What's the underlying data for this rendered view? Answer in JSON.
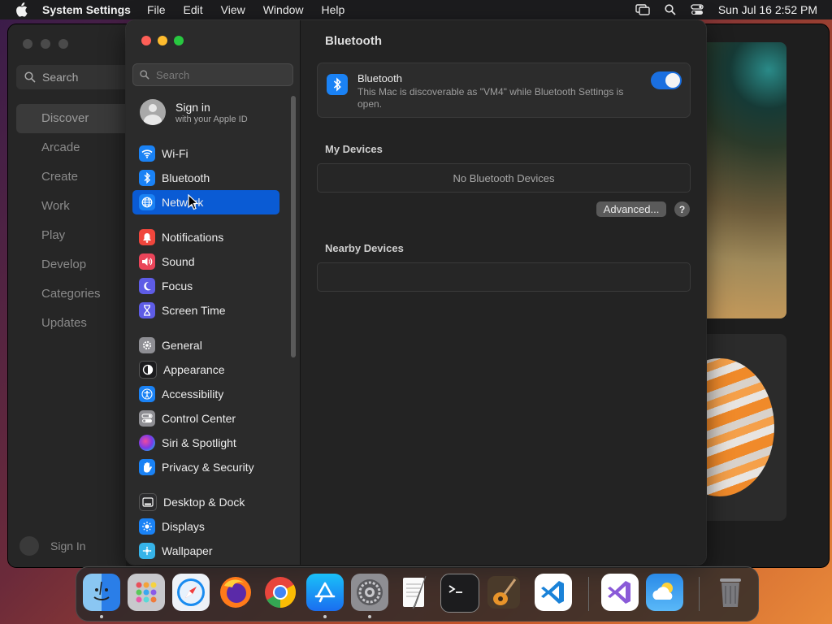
{
  "menubar": {
    "app_name": "System Settings",
    "menus": [
      "File",
      "Edit",
      "View",
      "Window",
      "Help"
    ],
    "clock": "Sun Jul 16  2:52 PM"
  },
  "background_app": {
    "search_label": "Search",
    "nav": [
      "Discover",
      "Arcade",
      "Create",
      "Work",
      "Play",
      "Develop",
      "Categories",
      "Updates"
    ],
    "active_nav": "Discover",
    "sign_in": "Sign In"
  },
  "sidebar": {
    "search_placeholder": "Search",
    "account": {
      "title": "Sign in",
      "subtitle": "with your Apple ID"
    },
    "items": [
      {
        "label": "Wi-Fi",
        "icon": "wifi-icon",
        "color": "#1a82f5"
      },
      {
        "label": "Bluetooth",
        "icon": "bluetooth-icon",
        "color": "#1a82f5"
      },
      {
        "label": "Network",
        "icon": "globe-icon",
        "color": "#1a82f5"
      },
      {
        "label": "Notifications",
        "icon": "bell-icon",
        "color": "#f0463c"
      },
      {
        "label": "Sound",
        "icon": "speaker-icon",
        "color": "#ea4459"
      },
      {
        "label": "Focus",
        "icon": "moon-icon",
        "color": "#5e5ce6"
      },
      {
        "label": "Screen Time",
        "icon": "hourglass-icon",
        "color": "#5e5ce6"
      },
      {
        "label": "General",
        "icon": "gear-icon",
        "color": "#8e8e93"
      },
      {
        "label": "Appearance",
        "icon": "appearance-icon",
        "color": "#1c1c1e"
      },
      {
        "label": "Accessibility",
        "icon": "accessibility-icon",
        "color": "#1a82f5"
      },
      {
        "label": "Control Center",
        "icon": "control-center-icon",
        "color": "#8e8e93"
      },
      {
        "label": "Siri & Spotlight",
        "icon": "siri-icon",
        "color": "#b04fd8"
      },
      {
        "label": "Privacy & Security",
        "icon": "hand-icon",
        "color": "#1a82f5"
      },
      {
        "label": "Desktop & Dock",
        "icon": "dock-icon",
        "color": "#2c2c2e"
      },
      {
        "label": "Displays",
        "icon": "sun-icon",
        "color": "#1a82f5"
      },
      {
        "label": "Wallpaper",
        "icon": "wallpaper-icon",
        "color": "#36b3e8"
      }
    ],
    "selected": "Network"
  },
  "content": {
    "title": "Bluetooth",
    "bluetooth": {
      "label": "Bluetooth",
      "description": "This Mac is discoverable as \"VM4\" while Bluetooth Settings is open.",
      "enabled": true
    },
    "my_devices": {
      "title": "My Devices",
      "empty_text": "No Bluetooth Devices"
    },
    "advanced_label": "Advanced...",
    "help_label": "?",
    "nearby_devices": {
      "title": "Nearby Devices"
    }
  },
  "dock": {
    "apps": [
      "Finder",
      "Launchpad",
      "Safari",
      "Firefox",
      "Chrome",
      "App Store",
      "System Settings",
      "TextEdit",
      "Terminal",
      "GarageBand",
      "Visual Studio Code",
      "Visual Studio",
      "Weather",
      "Trash"
    ]
  }
}
